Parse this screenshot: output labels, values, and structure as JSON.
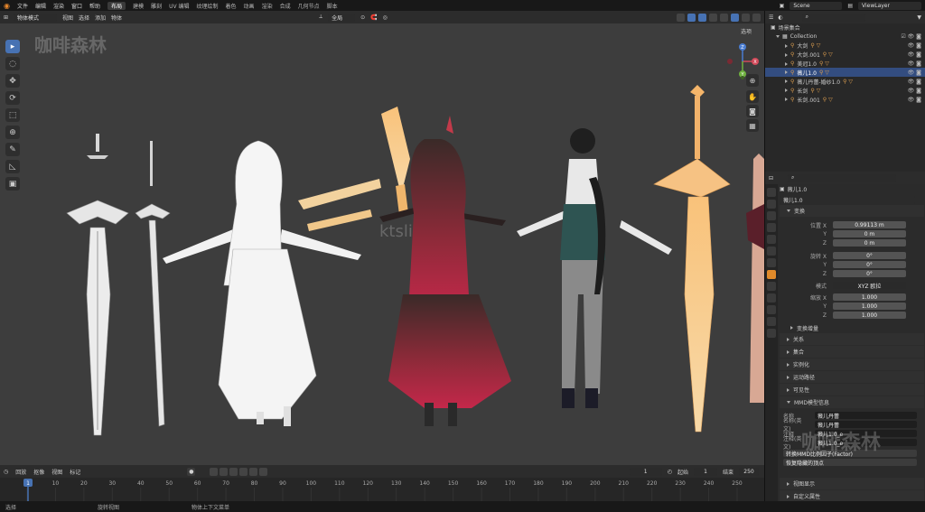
{
  "topbar": {
    "menus": [
      "文件",
      "编辑",
      "渲染",
      "窗口",
      "帮助"
    ],
    "workspaces": [
      "布局",
      "建模",
      "雕刻",
      "UV 编辑",
      "纹理绘制",
      "着色",
      "动画",
      "渲染",
      "合成",
      "几何节点",
      "脚本"
    ],
    "active_workspace": "布局",
    "scene": "Scene",
    "view_layer": "ViewLayer"
  },
  "viewport_header": {
    "mode": "物体模式",
    "menus": [
      "视图",
      "选择",
      "添加",
      "物体"
    ],
    "orientation": "全局",
    "options": "选项"
  },
  "gizmo": {
    "x": "X",
    "y": "Y",
    "z": "Z"
  },
  "watermarks": {
    "left": "咖啡森林",
    "center": "ktsli.com",
    "right": "咖啡森林"
  },
  "timeline": {
    "menus": [
      "回放",
      "抠像",
      "视图",
      "标记"
    ],
    "current_frame": "1",
    "start_label": "起始",
    "start": "1",
    "end_label": "结束",
    "end": "250",
    "ticks": [
      "0",
      "10",
      "20",
      "30",
      "40",
      "50",
      "60",
      "70",
      "80",
      "90",
      "100",
      "110",
      "120",
      "130",
      "140",
      "150",
      "160",
      "170",
      "180",
      "190",
      "200",
      "210",
      "220",
      "230",
      "240",
      "250"
    ],
    "cursor": "1"
  },
  "statusbar": {
    "select": "选择",
    "rotate": "旋转视图",
    "context": "物体上下文菜单"
  },
  "outliner": {
    "root": "场景集合",
    "collection": "Collection",
    "items": [
      {
        "name": "大剑",
        "selected": false
      },
      {
        "name": "大剑.001",
        "selected": false
      },
      {
        "name": "美冠1.0",
        "selected": false
      },
      {
        "name": "薇儿1.0",
        "selected": true
      },
      {
        "name": "薇儿丹蕾-婚纱1.0",
        "selected": false
      },
      {
        "name": "长剑",
        "selected": false
      },
      {
        "name": "长剑.001",
        "selected": false
      }
    ]
  },
  "properties": {
    "object_title": "薇儿1.0",
    "object_name": "薇儿1.0",
    "transform_label": "变换",
    "location": {
      "label": "位置 X",
      "x": "0.99113 m",
      "y": "0 m",
      "z": "0 m"
    },
    "rotation": {
      "label": "旋转 X",
      "x": "0°",
      "y": "0°",
      "z": "0°"
    },
    "mode_label": "模式",
    "mode": "XYZ 欧拉",
    "scale": {
      "label": "缩放 X",
      "x": "1.000",
      "y": "1.000",
      "z": "1.000"
    },
    "y_label": "Y",
    "z_label": "Z",
    "delta": "变换增量",
    "panels": [
      "关系",
      "集合",
      "实例化",
      "运动路径",
      "可见性"
    ],
    "mmd": {
      "title": "MMD模型信息",
      "name_label": "名称",
      "name": "薇儿丹蕾",
      "name_en_label": "名称(英文)",
      "name_en": "薇儿丹蕾",
      "comment_label": "注释",
      "comment": "薇儿1.0_e",
      "comment_en_label": "注释(英文)",
      "comment_en": "薇儿1.0_e",
      "scale_btn": "转换MMD比例因子(Factor)",
      "hidden_btn": "恢复隐藏的顶点"
    },
    "bottom_panels": [
      "视图显示",
      "自定义属性"
    ]
  },
  "colors": {
    "accent": "#4772b3",
    "selected_row": "#334d80",
    "viewport": "#3d3d3d"
  }
}
